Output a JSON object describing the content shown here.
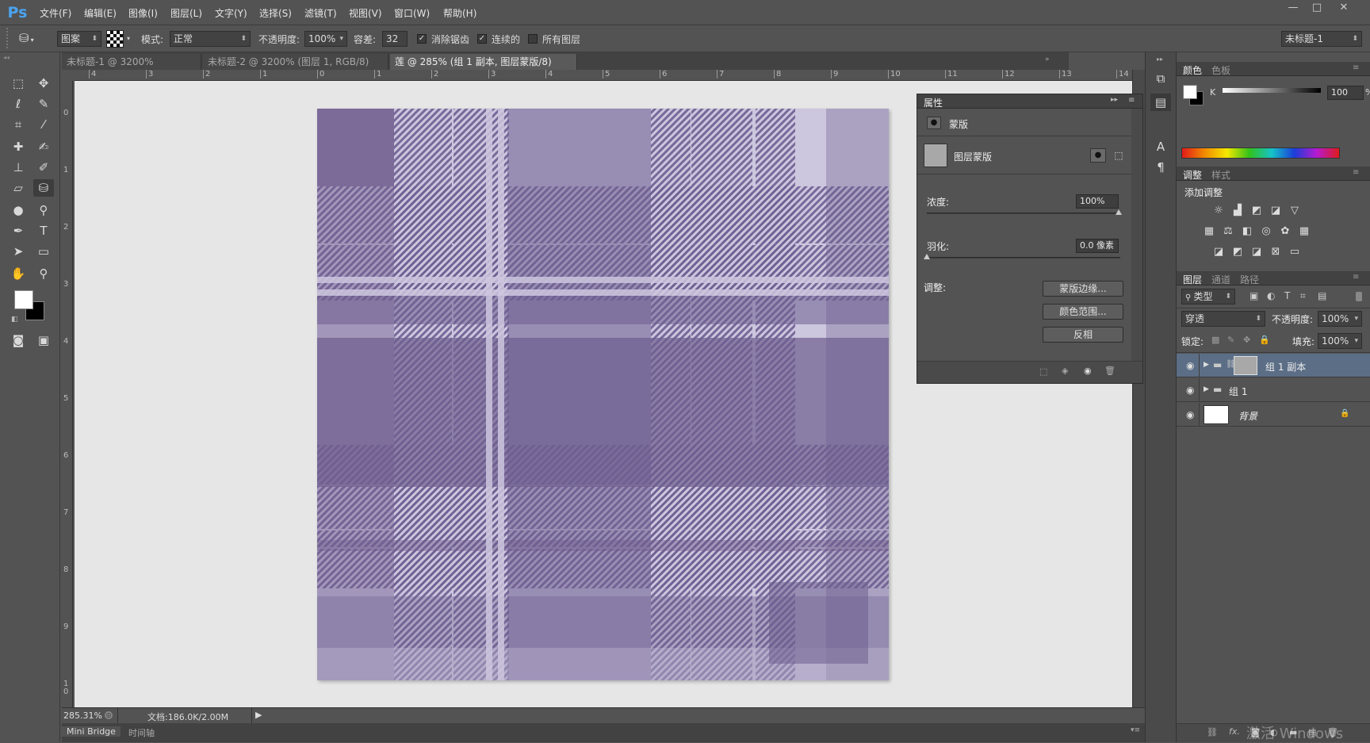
{
  "app": {
    "logo": "Ps"
  },
  "menu": [
    "文件(F)",
    "编辑(E)",
    "图像(I)",
    "图层(L)",
    "文字(Y)",
    "选择(S)",
    "滤镜(T)",
    "视图(V)",
    "窗口(W)",
    "帮助(H)"
  ],
  "window_controls": {
    "minimize": "—",
    "restore": "□",
    "close": "✕"
  },
  "options": {
    "tool_icon": "paint-bucket-icon",
    "fill_source": "图案",
    "mode_label": "模式:",
    "mode_value": "正常",
    "opacity_label": "不透明度:",
    "opacity_value": "100%",
    "tolerance_label": "容差:",
    "tolerance_value": "32",
    "antialias_label": "消除锯齿",
    "contiguous_label": "连续的",
    "all_layers_label": "所有图层",
    "workspace_label": "未标题-1"
  },
  "tabs": [
    {
      "label": "未标题-1 @ 3200%(RGB/8)",
      "close": "×",
      "active": false
    },
    {
      "label": "未标题-2 @ 3200% (图层 1, RGB/8) *",
      "close": "×",
      "active": false
    },
    {
      "label": "莲 @ 285% (组 1 副本, 图层蒙版/8) *",
      "close": "×",
      "active": true
    }
  ],
  "ruler_h": [
    "4",
    "3",
    "2",
    "1",
    "0",
    "1",
    "2",
    "3",
    "4",
    "5",
    "6",
    "7",
    "8",
    "9",
    "10",
    "11",
    "12",
    "13",
    "14"
  ],
  "ruler_v": [
    "0",
    "1",
    "2",
    "3",
    "4",
    "5",
    "6",
    "7",
    "8",
    "9",
    "1\n0"
  ],
  "status": {
    "zoom": "285.31%",
    "doc": "文档:186.0K/2.00M"
  },
  "bottom_tabs": [
    "Mini Bridge",
    "时间轴"
  ],
  "properties": {
    "title": "属性",
    "mask_label": "蒙版",
    "layer_mask_label": "图层蒙版",
    "density_label": "浓度:",
    "density_value": "100%",
    "feather_label": "羽化:",
    "feather_value": "0.0 像素",
    "adjust_label": "调整:",
    "btn_mask_edge": "蒙版边缘...",
    "btn_color_range": "颜色范围...",
    "btn_invert": "反相"
  },
  "color_panel": {
    "tabs": [
      "颜色",
      "色板"
    ],
    "channel": "K",
    "value": "100",
    "unit": "%"
  },
  "adjust_panel": {
    "tabs": [
      "调整",
      "样式"
    ],
    "add_label": "添加调整"
  },
  "layers_panel": {
    "tabs": [
      "图层",
      "通道",
      "路径"
    ],
    "filter_label": "类型",
    "blend_mode": "穿透",
    "opacity_label": "不透明度:",
    "opacity_value": "100%",
    "lock_label": "锁定:",
    "fill_label": "填充:",
    "fill_value": "100%",
    "layers": [
      {
        "name": "组 1 副本",
        "selected": true
      },
      {
        "name": "组 1",
        "selected": false
      },
      {
        "name": "背景",
        "selected": false
      }
    ],
    "footer_icons": [
      "link-icon",
      "fx-icon",
      "mask-icon",
      "adjustment-icon",
      "folder-icon",
      "new-layer-icon",
      "trash-icon"
    ],
    "watermark": "激活 Windows"
  },
  "colors": {
    "plaid_light": "#ccc6de",
    "plaid_mid": "#8877a3",
    "plaid_dark": "#6e5e8f",
    "selected_row": "#5b6e86"
  }
}
